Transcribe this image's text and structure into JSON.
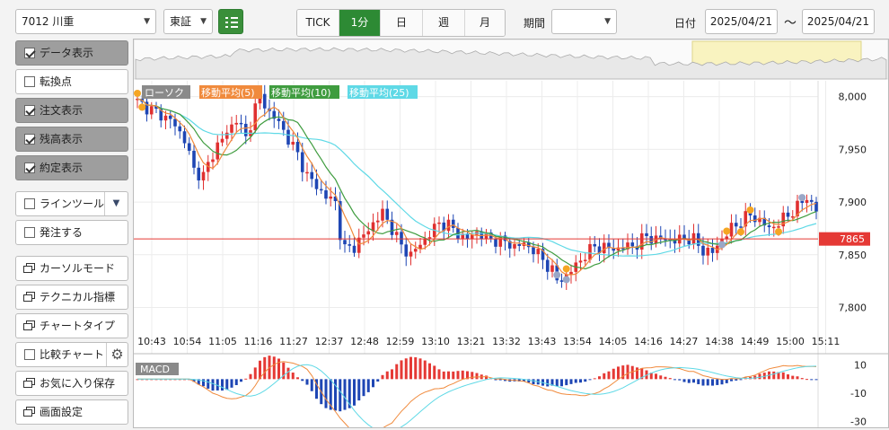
{
  "toolbar": {
    "symbol": "7012 川重",
    "exchange": "東証",
    "intervals": [
      "TICK",
      "1分",
      "日",
      "週",
      "月"
    ],
    "active_interval": "1分",
    "period_label": "期間",
    "period_value": "",
    "date_label": "日付",
    "date_from": "2025/04/21",
    "range_sep": "～",
    "date_to": "2025/04/21",
    "list_icon": "list-icon"
  },
  "sidebar": {
    "items": [
      {
        "label": "データ表示",
        "type": "check",
        "checked": true,
        "active": true
      },
      {
        "label": "転換点",
        "type": "check",
        "checked": false,
        "active": false
      },
      {
        "label": "注文表示",
        "type": "check",
        "checked": true,
        "active": true
      },
      {
        "label": "残高表示",
        "type": "check",
        "checked": true,
        "active": true
      },
      {
        "label": "約定表示",
        "type": "check",
        "checked": true,
        "active": true
      },
      {
        "label": "ラインツール",
        "type": "check-dropdown",
        "checked": false,
        "active": false
      },
      {
        "label": "発注する",
        "type": "check",
        "checked": false,
        "active": false
      },
      {
        "label": "カーソルモード",
        "type": "window",
        "active": false
      },
      {
        "label": "テクニカル指標",
        "type": "window",
        "active": false
      },
      {
        "label": "チャートタイプ",
        "type": "window",
        "active": false
      },
      {
        "label": "比較チャート",
        "type": "check-gear",
        "checked": false,
        "active": false
      },
      {
        "label": "お気に入り保存",
        "type": "window",
        "active": false
      },
      {
        "label": "画面設定",
        "type": "window",
        "active": false
      }
    ]
  },
  "chart_data": {
    "type": "candlestick",
    "legend": [
      {
        "label": "ローソク",
        "color": "#7a7a7a"
      },
      {
        "label": "移動平均(5)",
        "color": "#f08a3c"
      },
      {
        "label": "移動平均(10)",
        "color": "#3f9c3f"
      },
      {
        "label": "移動平均(25)",
        "color": "#5fd9e6"
      }
    ],
    "y_ticks": [
      "8,000",
      "7,950",
      "7,900",
      "7,850",
      "7,800"
    ],
    "y_tick_values": [
      8000,
      7950,
      7900,
      7850,
      7800
    ],
    "ylim": [
      7780,
      8015
    ],
    "x_ticks": [
      "10:43",
      "10:54",
      "11:05",
      "11:16",
      "11:27",
      "12:37",
      "12:48",
      "12:59",
      "13:10",
      "13:21",
      "13:32",
      "13:43",
      "13:54",
      "14:05",
      "14:16",
      "14:27",
      "14:38",
      "14:49",
      "15:00",
      "15:11"
    ],
    "current_price": "7865",
    "current_price_value": 7865,
    "price_path": [
      [
        0,
        7995
      ],
      [
        4,
        7985
      ],
      [
        7,
        7978
      ],
      [
        10,
        7960
      ],
      [
        12,
        7930
      ],
      [
        14,
        7925
      ],
      [
        17,
        7955
      ],
      [
        19,
        7965
      ],
      [
        21,
        7980
      ],
      [
        23,
        7960
      ],
      [
        25,
        7990
      ],
      [
        26,
        8000
      ],
      [
        28,
        7985
      ],
      [
        30,
        7975
      ],
      [
        32,
        7960
      ],
      [
        34,
        7945
      ],
      [
        36,
        7925
      ],
      [
        38,
        7915
      ],
      [
        40,
        7905
      ],
      [
        42,
        7900
      ],
      [
        43,
        7870
      ],
      [
        44,
        7855
      ],
      [
        46,
        7858
      ],
      [
        48,
        7868
      ],
      [
        50,
        7880
      ],
      [
        52,
        7890
      ],
      [
        54,
        7875
      ],
      [
        56,
        7858
      ],
      [
        58,
        7850
      ],
      [
        60,
        7860
      ],
      [
        62,
        7870
      ],
      [
        64,
        7880
      ],
      [
        66,
        7878
      ],
      [
        68,
        7870
      ],
      [
        70,
        7865
      ],
      [
        72,
        7872
      ],
      [
        74,
        7866
      ],
      [
        76,
        7864
      ],
      [
        78,
        7862
      ],
      [
        80,
        7858
      ],
      [
        82,
        7860
      ],
      [
        84,
        7855
      ],
      [
        86,
        7845
      ],
      [
        88,
        7835
      ],
      [
        89,
        7825
      ],
      [
        91,
        7830
      ],
      [
        93,
        7840
      ],
      [
        95,
        7850
      ],
      [
        97,
        7858
      ],
      [
        100,
        7856
      ],
      [
        102,
        7856
      ],
      [
        104,
        7858
      ],
      [
        106,
        7860
      ],
      [
        108,
        7868
      ],
      [
        110,
        7864
      ],
      [
        112,
        7866
      ],
      [
        114,
        7863
      ],
      [
        116,
        7866
      ],
      [
        118,
        7864
      ],
      [
        120,
        7854
      ],
      [
        122,
        7852
      ],
      [
        124,
        7865
      ],
      [
        126,
        7875
      ],
      [
        128,
        7882
      ],
      [
        130,
        7888
      ],
      [
        132,
        7882
      ],
      [
        134,
        7875
      ],
      [
        136,
        7880
      ],
      [
        138,
        7888
      ],
      [
        140,
        7895
      ],
      [
        142,
        7905
      ],
      [
        143,
        7898
      ],
      [
        144,
        7892
      ]
    ],
    "ma5_color": "#f08a3c",
    "ma10_color": "#3f9c3f",
    "ma25_color": "#5fd9e6",
    "up_color": "#e03030",
    "down_color": "#1e46b4",
    "macd": {
      "label": "MACD",
      "y_ticks": [
        "10",
        "-10",
        "-30"
      ],
      "y_tick_values": [
        10,
        -10,
        -30
      ],
      "ylim": [
        -33,
        13
      ]
    }
  }
}
